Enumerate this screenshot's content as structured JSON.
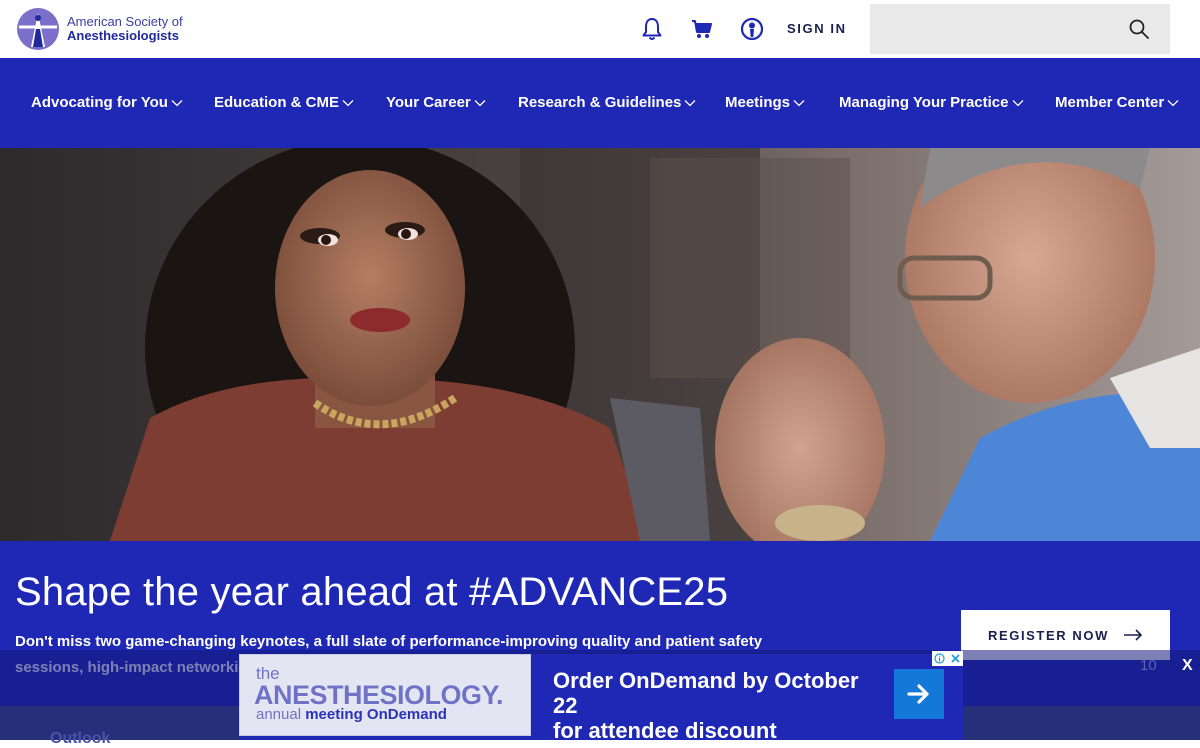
{
  "header": {
    "logo_line1": "American Society of",
    "logo_line2": "Anesthesiologists",
    "signin_label": "SIGN IN",
    "search_placeholder": "",
    "icons": [
      "bell-icon",
      "cart-icon",
      "user-icon",
      "search-icon"
    ]
  },
  "nav": {
    "items": [
      {
        "label": "Advocating for You"
      },
      {
        "label": "Education & CME"
      },
      {
        "label": "Your Career"
      },
      {
        "label": "Research & Guidelines"
      },
      {
        "label": "Meetings"
      },
      {
        "label": "Managing Your Practice"
      },
      {
        "label": "Member Center"
      }
    ]
  },
  "hero": {
    "title": "Shape the year ahead at #ADVANCE25",
    "description": "Don't miss two game-changing keynotes, a full slate of performance-improving quality and patient safety sessions, high-impact networkin",
    "cta_label": "REGISTER NOW",
    "below_text": "Outlook"
  },
  "ad": {
    "logo_the": "the",
    "logo_brand": "ANESTHESIOLOGY.",
    "logo_annual": "annual",
    "logo_meeting": "meeting",
    "logo_ondemand": "OnDemand",
    "offer_line1": "Order OnDemand by October 22",
    "offer_line2": "for attendee discount",
    "countdown": "10",
    "close_label": "X"
  },
  "colors": {
    "brand_blue": "#1e28b4",
    "cta_blue": "#1378d8",
    "logo_purple": "#7b6fc9"
  }
}
